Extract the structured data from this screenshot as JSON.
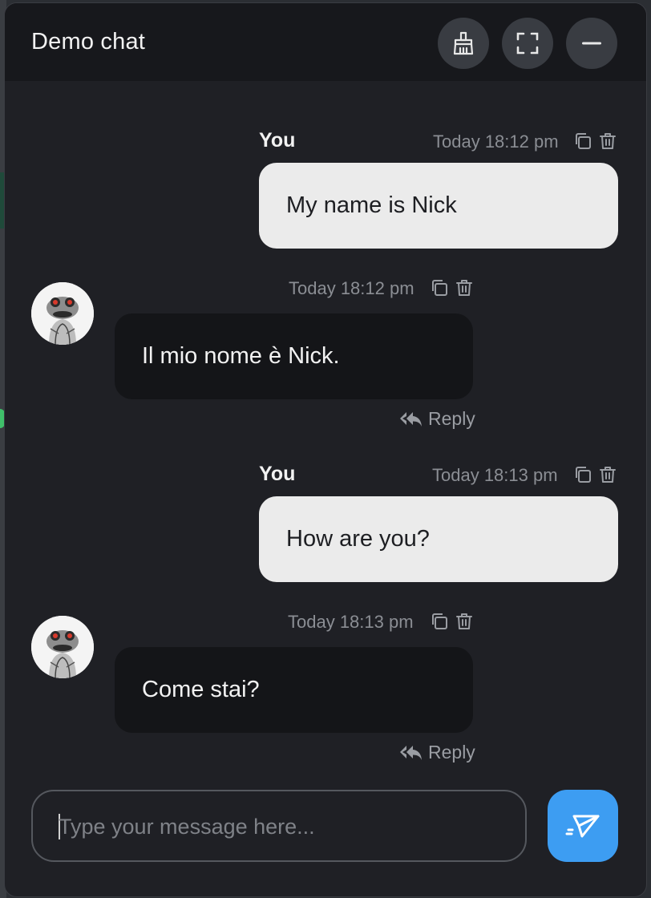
{
  "header": {
    "title": "Demo chat",
    "buttons": [
      {
        "icon": "broom-icon",
        "label": "Clear chat"
      },
      {
        "icon": "fullscreen-icon",
        "label": "Fullscreen"
      },
      {
        "icon": "minus-icon",
        "label": "Minimize"
      }
    ]
  },
  "messages": [
    {
      "direction": "outgoing",
      "sender": "You",
      "time": "Today 18:12 pm",
      "text": "My name is Nick"
    },
    {
      "direction": "incoming",
      "sender": "",
      "time": "Today 18:12 pm",
      "text": "Il mio nome è Nick.",
      "reply_label": "Reply"
    },
    {
      "direction": "outgoing",
      "sender": "You",
      "time": "Today 18:13 pm",
      "text": "How are you?"
    },
    {
      "direction": "incoming",
      "sender": "",
      "time": "Today 18:13 pm",
      "text": "Come stai?",
      "reply_label": "Reply"
    }
  ],
  "composer": {
    "placeholder": "Type your message here...",
    "value": ""
  },
  "colors": {
    "accent": "#3d9df2",
    "panel_bg": "#1f2025",
    "header_bg": "#17181c",
    "outgoing_bubble": "#ebebeb",
    "incoming_bubble": "#141518"
  }
}
